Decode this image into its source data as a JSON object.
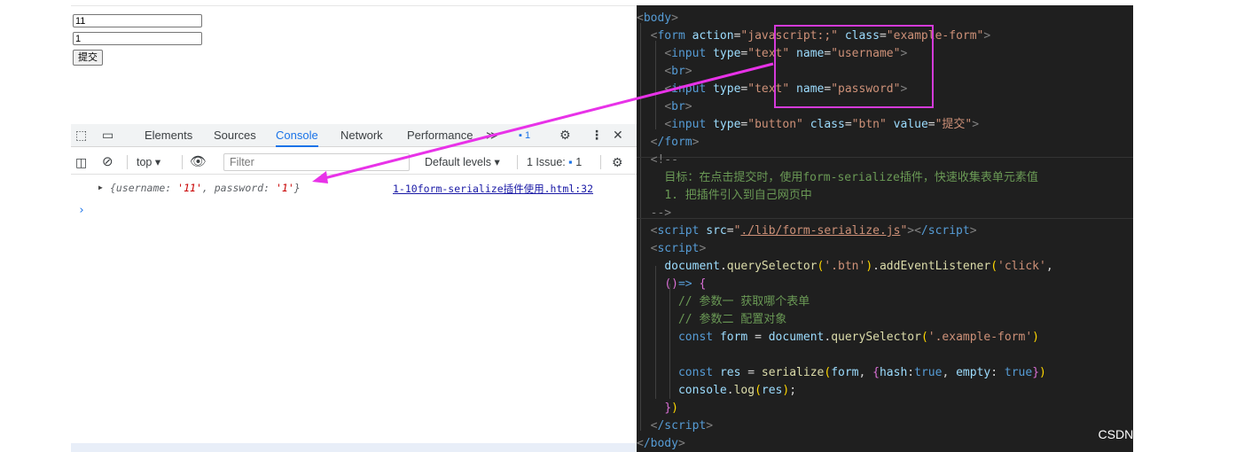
{
  "form": {
    "username_value": "11",
    "password_value": "1",
    "submit_label": "提交"
  },
  "devtools": {
    "tabs": [
      "Elements",
      "Sources",
      "Console",
      "Network",
      "Performance"
    ],
    "active_tab": "Console",
    "more_tabs": "≫",
    "issues_badge": "1",
    "context": "top",
    "filter_placeholder": "Filter",
    "levels": "Default levels",
    "issues_text": "1 Issue:",
    "issues_count": "1",
    "log_prefix": "{username: ",
    "log_username": "'11'",
    "log_mid": ", password: ",
    "log_password": "'1'",
    "log_suffix": "}",
    "log_source": "1-10form-serialize插件使用.html:32",
    "prompt": "›"
  },
  "code": {
    "l1_tag": "body",
    "l2_tag": "form",
    "l2_a1": "action",
    "l2_v1": "\"javascript:;\"",
    "l2_a2": "class",
    "l2_v2": "\"example-form\"",
    "l3_tag": "input",
    "l3_a1": "type",
    "l3_v1": "\"text\"",
    "l3_a2": "name",
    "l3_v2": "\"username\"",
    "br_tag": "br",
    "l5_v2": "\"password\"",
    "l7_a2": "class",
    "l7_v2": "\"btn\"",
    "l7_a3": "value",
    "l7_v3": "\"提交\"",
    "l7_v1": "\"button\"",
    "form_close": "/form",
    "cmt_open": "<!--",
    "cmt_1": "目标：在点击提交时，使用form-serialize插件，快速收集表单元素值",
    "cmt_2": "1. 把插件引入到自己网页中",
    "cmt_close": "-->",
    "script_tag": "script",
    "src_attr": "src",
    "src_val": "./lib/form-serialize.js",
    "script_close": "/script",
    "js1_obj": "document",
    "js1_m1": "querySelector",
    "js1_sel": "'.btn'",
    "js1_m2": "addEventListener",
    "js1_evt": "'click'",
    "js2": "()=> ",
    "js3": "// 参数一 获取哪个表单",
    "js4": "// 参数二 配置对象",
    "js5_kw": "const",
    "js5_var": "form",
    "js5_sel": "'.example-form'",
    "js6_var": "res",
    "js6_fn": "serialize",
    "js6_k1": "hash",
    "js6_k2": "empty",
    "js6_v": "true",
    "js7_obj": "console",
    "js7_fn": "log",
    "body_close": "/body"
  },
  "watermark": "CSDN @aPurpleBerry",
  "colors": {
    "arrow": "#e832e8",
    "highlight_box": "#d43ad9",
    "devtools_accent": "#1a73e8"
  }
}
